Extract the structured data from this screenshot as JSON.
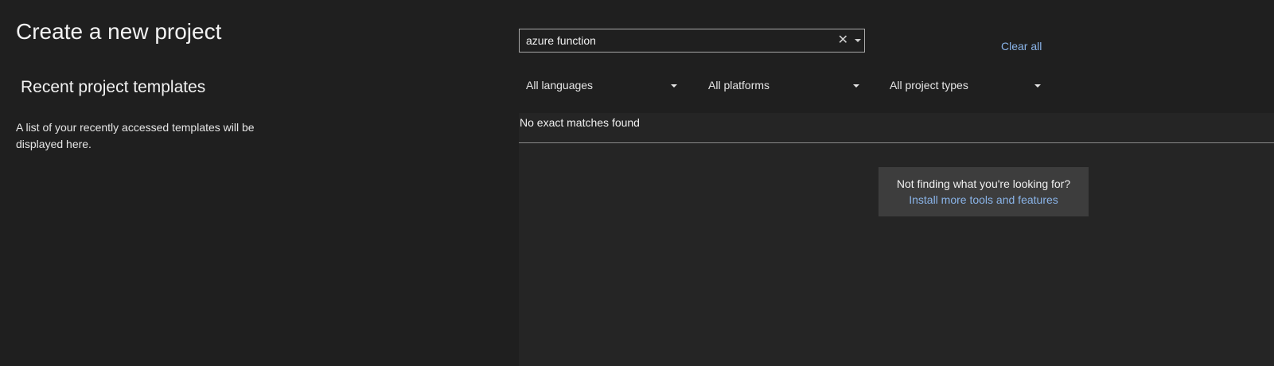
{
  "page": {
    "title": "Create a new project"
  },
  "recent": {
    "heading": "Recent project templates",
    "empty_message": "A list of your recently accessed templates will be displayed here."
  },
  "search": {
    "value": "azure function",
    "clear_icon": "close-icon",
    "dropdown_icon": "chevron-down-icon"
  },
  "clear_all_label": "Clear all",
  "filters": [
    {
      "label": "All languages",
      "icon": "chevron-down-icon"
    },
    {
      "label": "All platforms",
      "icon": "chevron-down-icon"
    },
    {
      "label": "All project types",
      "icon": "chevron-down-icon"
    }
  ],
  "results": {
    "status": "No exact matches found",
    "help_prompt": "Not finding what you're looking for?",
    "help_link": "Install more tools and features"
  },
  "colors": {
    "background": "#1f1f1f",
    "results_background": "#252525",
    "card_background": "#3d3d3d",
    "link": "#8ab4e8",
    "text": "#f0f0f0"
  }
}
